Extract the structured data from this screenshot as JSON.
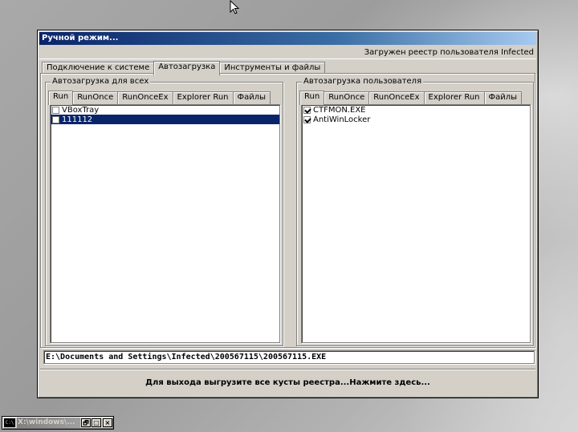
{
  "window": {
    "title": "Ручной режим...",
    "status": "Загружен реестр пользователя Infected"
  },
  "main_tabs": [
    "Подключение к системе",
    "Автозагрузка",
    "Инструменты и файлы"
  ],
  "left_group": {
    "label": "Автозагрузка для всех",
    "tabs": [
      "Run",
      "RunOnce",
      "RunOnceEx",
      "Explorer Run",
      "Файлы"
    ],
    "items": [
      {
        "label": "VBoxTray",
        "checked": false,
        "selected": false
      },
      {
        "label": "111112",
        "checked": false,
        "selected": true
      }
    ]
  },
  "right_group": {
    "label": "Автозагрузка пользователя",
    "tabs": [
      "Run",
      "RunOnce",
      "RunOnceEx",
      "Explorer Run",
      "Файлы"
    ],
    "items": [
      {
        "label": "CTFMON.EXE",
        "checked": true,
        "selected": false
      },
      {
        "label": "AntiWinLocker",
        "checked": true,
        "selected": false
      }
    ]
  },
  "path": "E:\\Documents and Settings\\Infected\\200567115\\200567115.EXE",
  "exit_label": "Для выхода выгрузите все кусты реестра...Нажмите здесь...",
  "taskbar": {
    "icon_text": "C:\\",
    "title": "X:\\windows\\...",
    "restore": "🗗",
    "max": "□",
    "close": "×"
  }
}
